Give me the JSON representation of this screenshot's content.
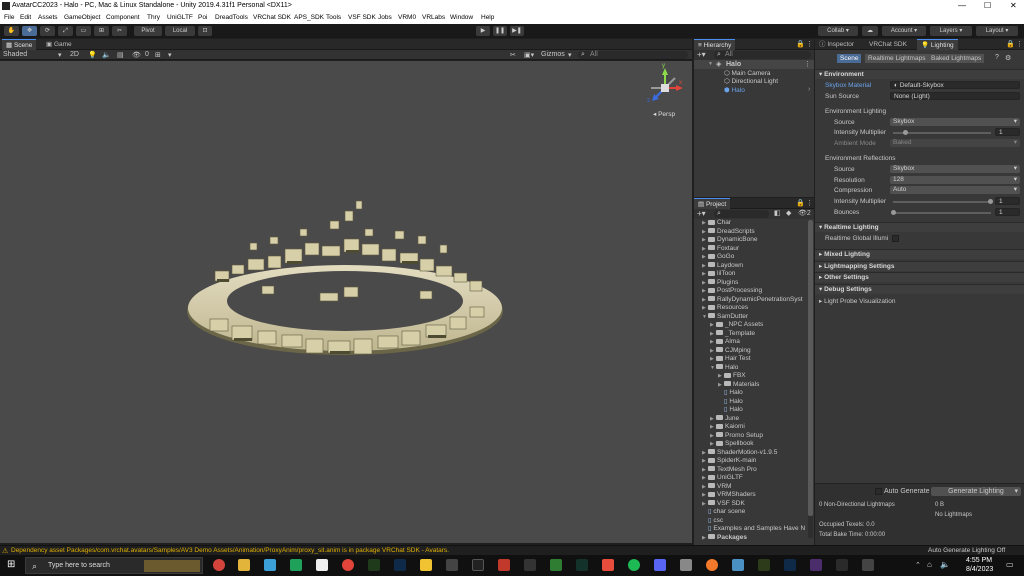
{
  "window": {
    "title": "AvatarCC2023 - Halo - PC, Mac & Linux Standalone - Unity 2019.4.31f1 Personal <DX11>",
    "controls": [
      "—",
      "☐",
      "✕"
    ]
  },
  "menubar": [
    "File",
    "Edit",
    "Assets",
    "GameObject",
    "Component",
    "Thry",
    "UniGLTF",
    "Poi",
    "DreadTools",
    "VRChat SDK",
    "APS_SDK",
    "Tools",
    "VSF SDK",
    "Jobs",
    "VRM0",
    "VRLabs",
    "Window",
    "Help"
  ],
  "toolbar": {
    "pivot": "Pivot",
    "local": "Local",
    "collab": "Collab ▾",
    "account": "Account",
    "layers": "Layers",
    "layout": "Layout"
  },
  "scene_panel": {
    "tabs": [
      "Scene",
      "Game"
    ],
    "shading": "Shaded",
    "mode_2d": "2D",
    "fx_count": "0",
    "gizmos": "Gizmos",
    "search_placeholder": "All",
    "persp": "Persp",
    "axes": {
      "x": "x",
      "y": "y",
      "z": "z"
    }
  },
  "hierarchy": {
    "title": "Hierarchy",
    "search_placeholder": "All",
    "scene": "Halo",
    "items": [
      "Main Camera",
      "Directional Light",
      "Halo"
    ]
  },
  "project": {
    "title": "Project",
    "badge": "2",
    "items": [
      {
        "label": "Char",
        "depth": 0
      },
      {
        "label": "DreadScripts",
        "depth": 0
      },
      {
        "label": "DynamicBone",
        "depth": 0
      },
      {
        "label": "Foxtaur",
        "depth": 0
      },
      {
        "label": "GoGo",
        "depth": 0
      },
      {
        "label": "Laydown",
        "depth": 0
      },
      {
        "label": "lilToon",
        "depth": 0
      },
      {
        "label": "Plugins",
        "depth": 0
      },
      {
        "label": "PostProcessing",
        "depth": 0
      },
      {
        "label": "RallyDynamicPenetrationSyst",
        "depth": 0
      },
      {
        "label": "Resources",
        "depth": 0
      },
      {
        "label": "SamDutter",
        "depth": 0
      },
      {
        "label": "_NPC Assets",
        "depth": 1
      },
      {
        "label": "_Template",
        "depth": 1
      },
      {
        "label": "Alma",
        "depth": 1
      },
      {
        "label": "CJMping",
        "depth": 1
      },
      {
        "label": "Hair Test",
        "depth": 1
      },
      {
        "label": "Halo",
        "depth": 1
      },
      {
        "label": "FBX",
        "depth": 2
      },
      {
        "label": "Materials",
        "depth": 2
      },
      {
        "label": "Halo",
        "depth": 2
      },
      {
        "label": "Halo",
        "depth": 2
      },
      {
        "label": "Halo",
        "depth": 2
      },
      {
        "label": "June",
        "depth": 1
      },
      {
        "label": "Kaiomi",
        "depth": 1
      },
      {
        "label": "Promo Setup",
        "depth": 1
      },
      {
        "label": "Spellbook",
        "depth": 1
      },
      {
        "label": "ShaderMotion-v1.9.5",
        "depth": 0
      },
      {
        "label": "SpiderK-main",
        "depth": 0
      },
      {
        "label": "TextMesh Pro",
        "depth": 0
      },
      {
        "label": "UniGLTF",
        "depth": 0
      },
      {
        "label": "VRM",
        "depth": 0
      },
      {
        "label": "VRMShaders",
        "depth": 0
      },
      {
        "label": "VSF SDK",
        "depth": 0
      },
      {
        "label": "char scene",
        "depth": 0
      },
      {
        "label": "csc",
        "depth": 0
      },
      {
        "label": "Examples and Samples Have N",
        "depth": 0
      },
      {
        "label": "Packages",
        "depth": 0
      }
    ]
  },
  "inspector": {
    "tabs": [
      "Inspector",
      "VRChat SDK",
      "Lighting"
    ],
    "subtabs": [
      "Scene",
      "Realtime Lightmaps",
      "Baked Lightmaps"
    ],
    "environment": {
      "header": "Environment",
      "skybox_label": "Skybox Material",
      "skybox_value": "Default-Skybox",
      "sun_label": "Sun Source",
      "sun_value": "None (Light)",
      "lighting_header": "Environment Lighting",
      "source_label": "Source",
      "source_value": "Skybox",
      "intensity_label": "Intensity Multiplier",
      "intensity_value": "1",
      "ambient_label": "Ambient Mode",
      "ambient_value": "Baked",
      "reflections_header": "Environment Reflections",
      "r_source_label": "Source",
      "r_source_value": "Skybox",
      "resolution_label": "Resolution",
      "resolution_value": "128",
      "compression_label": "Compression",
      "compression_value": "Auto",
      "r_intensity_label": "Intensity Multiplier",
      "r_intensity_value": "1",
      "bounces_label": "Bounces",
      "bounces_value": "1"
    },
    "realtime": {
      "header": "Realtime Lighting",
      "gi_label": "Realtime Global Illumi"
    },
    "mixed": "Mixed Lighting",
    "lightmapping": "Lightmapping Settings",
    "other": "Other Settings",
    "debug": {
      "header": "Debug Settings",
      "probe": "Light Probe Visualization"
    },
    "bottom": {
      "auto_generate": "Auto Generate",
      "generate_button": "Generate Lighting",
      "non_dir": "0 Non-Directional Lightmaps",
      "size": "0 B",
      "no_lightmaps": "No Lightmaps",
      "occupied": "Occupied Texels: 0.0",
      "bake_time": "Total Bake Time: 0:00:00"
    }
  },
  "status": {
    "warning": "Dependency asset Packages/com.vrchat.avatars/Samples/AV3 Demo Assets/Animation/ProxyAnim/proxy_sit.anim is in package VRChat SDK - Avatars.",
    "right": "Auto Generate Lighting Off"
  },
  "taskbar": {
    "search_placeholder": "Type here to search",
    "time": "4:55 PM",
    "date": "8/4/2023"
  },
  "colors": {
    "accent": "#4a8eef",
    "selection": "#2c5d87",
    "warning": "#e0b000"
  }
}
